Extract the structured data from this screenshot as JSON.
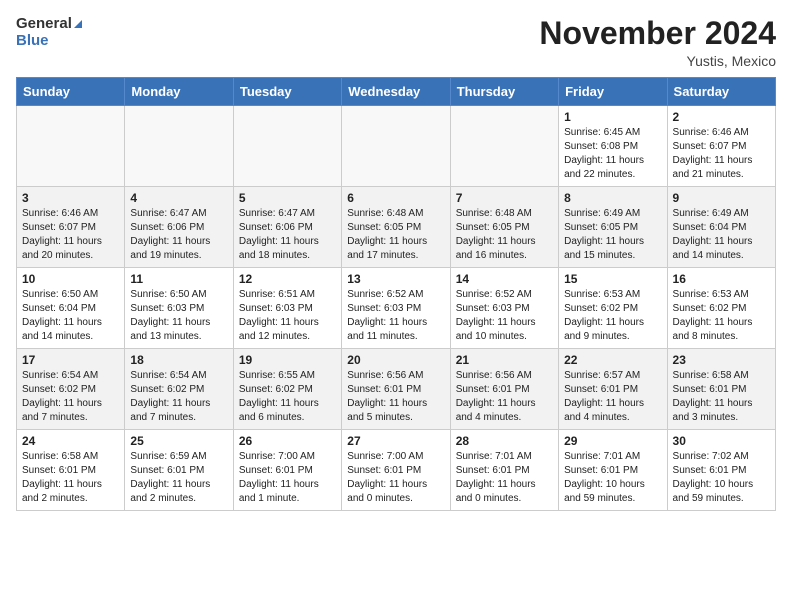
{
  "header": {
    "logo_line1": "General",
    "logo_line2": "Blue",
    "month": "November 2024",
    "location": "Yustis, Mexico"
  },
  "weekdays": [
    "Sunday",
    "Monday",
    "Tuesday",
    "Wednesday",
    "Thursday",
    "Friday",
    "Saturday"
  ],
  "weeks": [
    [
      {
        "day": "",
        "detail": ""
      },
      {
        "day": "",
        "detail": ""
      },
      {
        "day": "",
        "detail": ""
      },
      {
        "day": "",
        "detail": ""
      },
      {
        "day": "",
        "detail": ""
      },
      {
        "day": "1",
        "detail": "Sunrise: 6:45 AM\nSunset: 6:08 PM\nDaylight: 11 hours\nand 22 minutes."
      },
      {
        "day": "2",
        "detail": "Sunrise: 6:46 AM\nSunset: 6:07 PM\nDaylight: 11 hours\nand 21 minutes."
      }
    ],
    [
      {
        "day": "3",
        "detail": "Sunrise: 6:46 AM\nSunset: 6:07 PM\nDaylight: 11 hours\nand 20 minutes."
      },
      {
        "day": "4",
        "detail": "Sunrise: 6:47 AM\nSunset: 6:06 PM\nDaylight: 11 hours\nand 19 minutes."
      },
      {
        "day": "5",
        "detail": "Sunrise: 6:47 AM\nSunset: 6:06 PM\nDaylight: 11 hours\nand 18 minutes."
      },
      {
        "day": "6",
        "detail": "Sunrise: 6:48 AM\nSunset: 6:05 PM\nDaylight: 11 hours\nand 17 minutes."
      },
      {
        "day": "7",
        "detail": "Sunrise: 6:48 AM\nSunset: 6:05 PM\nDaylight: 11 hours\nand 16 minutes."
      },
      {
        "day": "8",
        "detail": "Sunrise: 6:49 AM\nSunset: 6:05 PM\nDaylight: 11 hours\nand 15 minutes."
      },
      {
        "day": "9",
        "detail": "Sunrise: 6:49 AM\nSunset: 6:04 PM\nDaylight: 11 hours\nand 14 minutes."
      }
    ],
    [
      {
        "day": "10",
        "detail": "Sunrise: 6:50 AM\nSunset: 6:04 PM\nDaylight: 11 hours\nand 14 minutes."
      },
      {
        "day": "11",
        "detail": "Sunrise: 6:50 AM\nSunset: 6:03 PM\nDaylight: 11 hours\nand 13 minutes."
      },
      {
        "day": "12",
        "detail": "Sunrise: 6:51 AM\nSunset: 6:03 PM\nDaylight: 11 hours\nand 12 minutes."
      },
      {
        "day": "13",
        "detail": "Sunrise: 6:52 AM\nSunset: 6:03 PM\nDaylight: 11 hours\nand 11 minutes."
      },
      {
        "day": "14",
        "detail": "Sunrise: 6:52 AM\nSunset: 6:03 PM\nDaylight: 11 hours\nand 10 minutes."
      },
      {
        "day": "15",
        "detail": "Sunrise: 6:53 AM\nSunset: 6:02 PM\nDaylight: 11 hours\nand 9 minutes."
      },
      {
        "day": "16",
        "detail": "Sunrise: 6:53 AM\nSunset: 6:02 PM\nDaylight: 11 hours\nand 8 minutes."
      }
    ],
    [
      {
        "day": "17",
        "detail": "Sunrise: 6:54 AM\nSunset: 6:02 PM\nDaylight: 11 hours\nand 7 minutes."
      },
      {
        "day": "18",
        "detail": "Sunrise: 6:54 AM\nSunset: 6:02 PM\nDaylight: 11 hours\nand 7 minutes."
      },
      {
        "day": "19",
        "detail": "Sunrise: 6:55 AM\nSunset: 6:02 PM\nDaylight: 11 hours\nand 6 minutes."
      },
      {
        "day": "20",
        "detail": "Sunrise: 6:56 AM\nSunset: 6:01 PM\nDaylight: 11 hours\nand 5 minutes."
      },
      {
        "day": "21",
        "detail": "Sunrise: 6:56 AM\nSunset: 6:01 PM\nDaylight: 11 hours\nand 4 minutes."
      },
      {
        "day": "22",
        "detail": "Sunrise: 6:57 AM\nSunset: 6:01 PM\nDaylight: 11 hours\nand 4 minutes."
      },
      {
        "day": "23",
        "detail": "Sunrise: 6:58 AM\nSunset: 6:01 PM\nDaylight: 11 hours\nand 3 minutes."
      }
    ],
    [
      {
        "day": "24",
        "detail": "Sunrise: 6:58 AM\nSunset: 6:01 PM\nDaylight: 11 hours\nand 2 minutes."
      },
      {
        "day": "25",
        "detail": "Sunrise: 6:59 AM\nSunset: 6:01 PM\nDaylight: 11 hours\nand 2 minutes."
      },
      {
        "day": "26",
        "detail": "Sunrise: 7:00 AM\nSunset: 6:01 PM\nDaylight: 11 hours\nand 1 minute."
      },
      {
        "day": "27",
        "detail": "Sunrise: 7:00 AM\nSunset: 6:01 PM\nDaylight: 11 hours\nand 0 minutes."
      },
      {
        "day": "28",
        "detail": "Sunrise: 7:01 AM\nSunset: 6:01 PM\nDaylight: 11 hours\nand 0 minutes."
      },
      {
        "day": "29",
        "detail": "Sunrise: 7:01 AM\nSunset: 6:01 PM\nDaylight: 10 hours\nand 59 minutes."
      },
      {
        "day": "30",
        "detail": "Sunrise: 7:02 AM\nSunset: 6:01 PM\nDaylight: 10 hours\nand 59 minutes."
      }
    ]
  ]
}
